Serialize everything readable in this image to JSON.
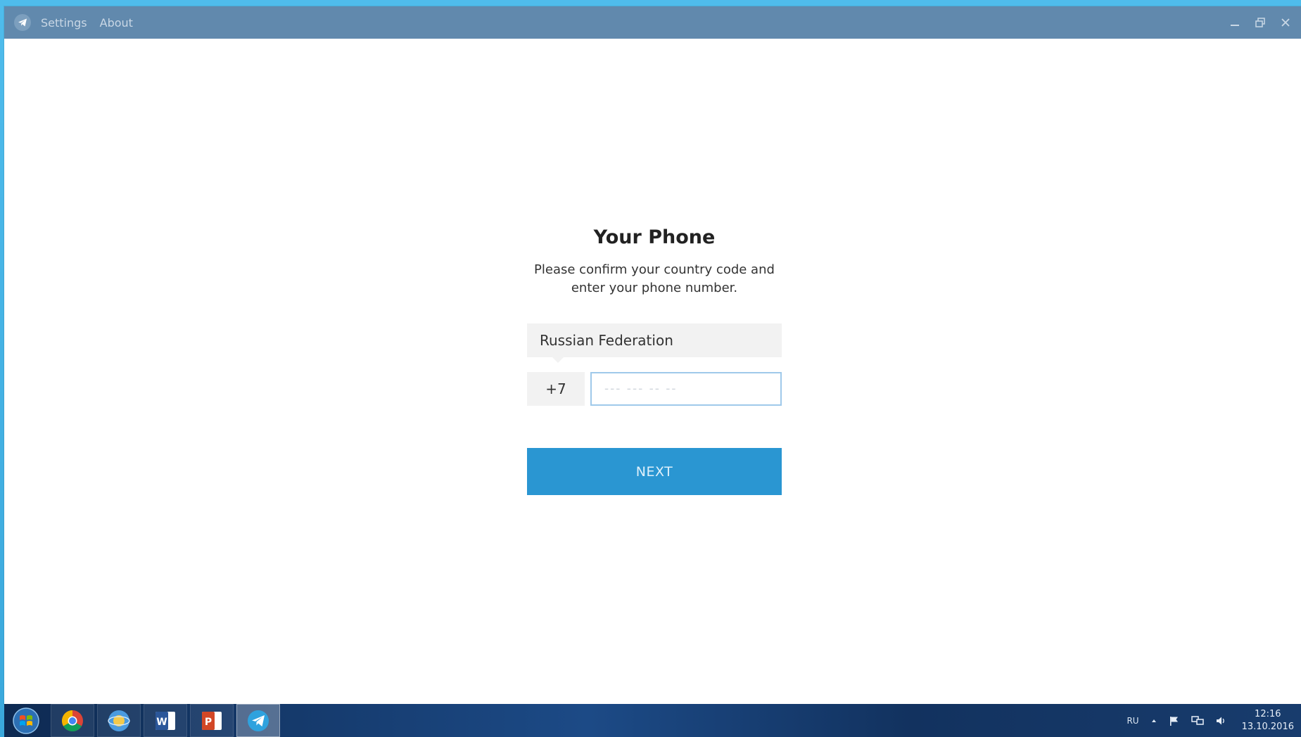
{
  "window": {
    "menu": [
      "Settings",
      "About"
    ]
  },
  "login": {
    "title": "Your Phone",
    "description_line1": "Please confirm your country code and",
    "description_line2": "enter your phone number.",
    "country": "Russian Federation",
    "country_code": "+7",
    "phone_placeholder": "--- --- -- --",
    "phone_value": "",
    "next_label": "NEXT"
  },
  "taskbar": {
    "apps": [
      {
        "icon": "windows-start-icon"
      },
      {
        "icon": "chrome-icon"
      },
      {
        "icon": "browser-globe-icon"
      },
      {
        "icon": "word-icon"
      },
      {
        "icon": "powerpoint-icon"
      },
      {
        "icon": "telegram-icon"
      }
    ],
    "language": "RU",
    "time": "12:16",
    "date": "13.10.2016"
  },
  "colors": {
    "titlebar": "#6189ad",
    "accent": "#2a96d2",
    "field_bg": "#f2f2f2",
    "input_border": "#9fc9ea"
  }
}
